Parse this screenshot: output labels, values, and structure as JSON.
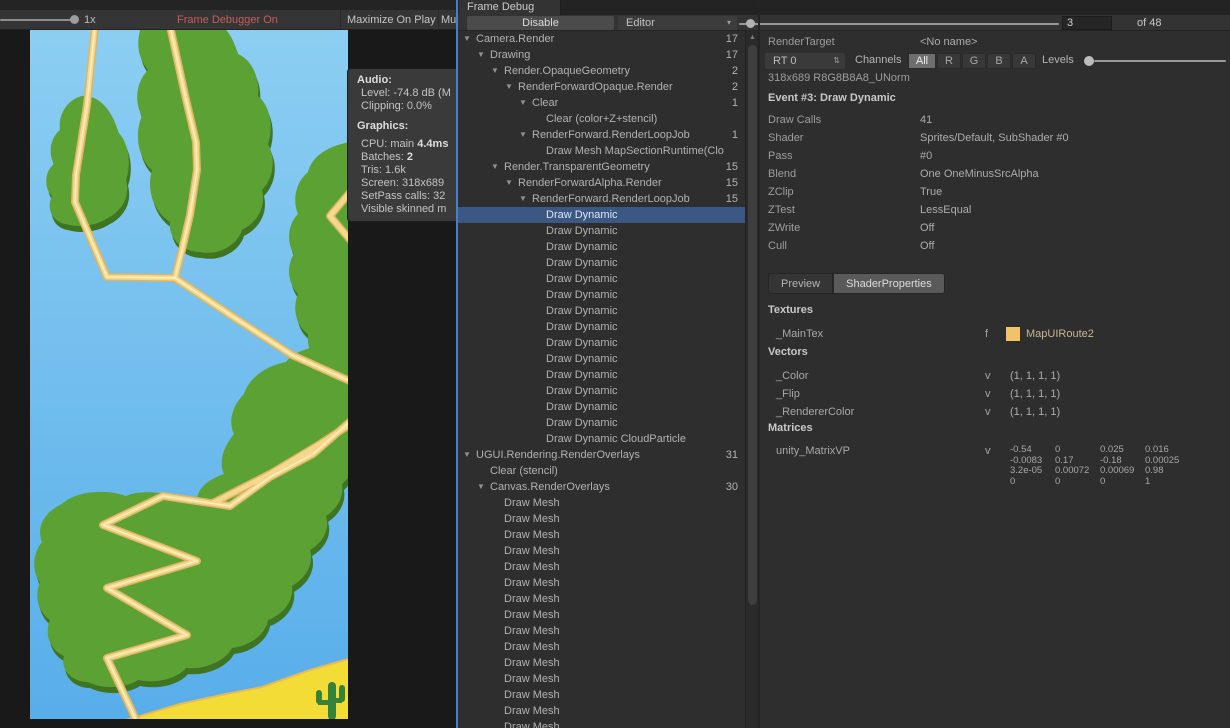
{
  "game_toolbar": {
    "scale_label": "1x",
    "frame_debugger_status": "Frame Debugger On",
    "maximize_on_play_label": "Maximize On Play",
    "mute_label_clipped": "Mu"
  },
  "stats_overlay": {
    "audio_header": "Audio:",
    "audio_lines": [
      {
        "label": "Level: -74.8 dB (M",
        "value": ""
      },
      {
        "label": "Clipping: 0.0%",
        "value": ""
      }
    ],
    "graphics_header": "Graphics:",
    "graphics_lines": [
      {
        "label": "CPU: main ",
        "value": "4.4ms"
      },
      {
        "label": "Batches: ",
        "value": "2"
      },
      {
        "label": "Tris: 1.6k",
        "value": ""
      },
      {
        "label": "Screen: 318x689",
        "value": ""
      },
      {
        "label": "SetPass calls: 32",
        "value": ""
      },
      {
        "label": "Visible skinned m",
        "value": ""
      }
    ]
  },
  "frame_debug": {
    "tab_title": "Frame Debug",
    "toolbar": {
      "disable_button": "Disable",
      "target_dropdown": "Editor",
      "event_number": "3",
      "event_total_label": "of 48"
    },
    "tree": [
      {
        "label": "Camera.Render",
        "count": "17",
        "depth": 0,
        "arrow": true
      },
      {
        "label": "Drawing",
        "count": "17",
        "depth": 1,
        "arrow": true
      },
      {
        "label": "Render.OpaqueGeometry",
        "count": "2",
        "depth": 2,
        "arrow": true
      },
      {
        "label": "RenderForwardOpaque.Render",
        "count": "2",
        "depth": 3,
        "arrow": true
      },
      {
        "label": "Clear",
        "count": "1",
        "depth": 4,
        "arrow": true
      },
      {
        "label": "Clear (color+Z+stencil)",
        "count": "",
        "depth": 5,
        "arrow": false
      },
      {
        "label": "RenderForward.RenderLoopJob",
        "count": "1",
        "depth": 4,
        "arrow": true
      },
      {
        "label": "Draw Mesh MapSectionRuntime(Clo",
        "count": "",
        "depth": 5,
        "arrow": false
      },
      {
        "label": "Render.TransparentGeometry",
        "count": "15",
        "depth": 2,
        "arrow": true
      },
      {
        "label": "RenderForwardAlpha.Render",
        "count": "15",
        "depth": 3,
        "arrow": true
      },
      {
        "label": "RenderForward.RenderLoopJob",
        "count": "15",
        "depth": 4,
        "arrow": true
      },
      {
        "label": "Draw Dynamic",
        "count": "",
        "depth": 5,
        "arrow": false,
        "selected": true
      },
      {
        "label": "Draw Dynamic",
        "count": "",
        "depth": 5,
        "arrow": false
      },
      {
        "label": "Draw Dynamic",
        "count": "",
        "depth": 5,
        "arrow": false
      },
      {
        "label": "Draw Dynamic",
        "count": "",
        "depth": 5,
        "arrow": false
      },
      {
        "label": "Draw Dynamic",
        "count": "",
        "depth": 5,
        "arrow": false
      },
      {
        "label": "Draw Dynamic",
        "count": "",
        "depth": 5,
        "arrow": false
      },
      {
        "label": "Draw Dynamic",
        "count": "",
        "depth": 5,
        "arrow": false
      },
      {
        "label": "Draw Dynamic",
        "count": "",
        "depth": 5,
        "arrow": false
      },
      {
        "label": "Draw Dynamic",
        "count": "",
        "depth": 5,
        "arrow": false
      },
      {
        "label": "Draw Dynamic",
        "count": "",
        "depth": 5,
        "arrow": false
      },
      {
        "label": "Draw Dynamic",
        "count": "",
        "depth": 5,
        "arrow": false
      },
      {
        "label": "Draw Dynamic",
        "count": "",
        "depth": 5,
        "arrow": false
      },
      {
        "label": "Draw Dynamic",
        "count": "",
        "depth": 5,
        "arrow": false
      },
      {
        "label": "Draw Dynamic",
        "count": "",
        "depth": 5,
        "arrow": false
      },
      {
        "label": "Draw Dynamic CloudParticle",
        "count": "",
        "depth": 5,
        "arrow": false
      },
      {
        "label": "UGUI.Rendering.RenderOverlays",
        "count": "31",
        "depth": 0,
        "arrow": true
      },
      {
        "label": "Clear (stencil)",
        "count": "",
        "depth": 1,
        "arrow": false
      },
      {
        "label": "Canvas.RenderOverlays",
        "count": "30",
        "depth": 1,
        "arrow": true
      },
      {
        "label": "Draw Mesh",
        "count": "",
        "depth": 2,
        "arrow": false
      },
      {
        "label": "Draw Mesh",
        "count": "",
        "depth": 2,
        "arrow": false
      },
      {
        "label": "Draw Mesh",
        "count": "",
        "depth": 2,
        "arrow": false
      },
      {
        "label": "Draw Mesh",
        "count": "",
        "depth": 2,
        "arrow": false
      },
      {
        "label": "Draw Mesh",
        "count": "",
        "depth": 2,
        "arrow": false
      },
      {
        "label": "Draw Mesh",
        "count": "",
        "depth": 2,
        "arrow": false
      },
      {
        "label": "Draw Mesh",
        "count": "",
        "depth": 2,
        "arrow": false
      },
      {
        "label": "Draw Mesh",
        "count": "",
        "depth": 2,
        "arrow": false
      },
      {
        "label": "Draw Mesh",
        "count": "",
        "depth": 2,
        "arrow": false
      },
      {
        "label": "Draw Mesh",
        "count": "",
        "depth": 2,
        "arrow": false
      },
      {
        "label": "Draw Mesh",
        "count": "",
        "depth": 2,
        "arrow": false
      },
      {
        "label": "Draw Mesh",
        "count": "",
        "depth": 2,
        "arrow": false
      },
      {
        "label": "Draw Mesh",
        "count": "",
        "depth": 2,
        "arrow": false
      },
      {
        "label": "Draw Mesh",
        "count": "",
        "depth": 2,
        "arrow": false
      },
      {
        "label": "Draw Mesh",
        "count": "",
        "depth": 2,
        "arrow": false
      }
    ]
  },
  "details": {
    "render_target_label": "RenderTarget",
    "render_target_value": "<No name>",
    "rt_dropdown": "RT 0",
    "channels_label": "Channels",
    "channels": [
      "All",
      "R",
      "G",
      "B",
      "A"
    ],
    "active_channel": "All",
    "levels_label": "Levels",
    "buffer_info": "318x689 R8G8B8A8_UNorm",
    "event_title": "Event #3: Draw Dynamic",
    "properties": [
      {
        "label": "Draw Calls",
        "value": "41"
      },
      {
        "label": "Shader",
        "value": "Sprites/Default, SubShader #0"
      },
      {
        "label": "Pass",
        "value": "#0"
      },
      {
        "label": "Blend",
        "value": "One OneMinusSrcAlpha"
      },
      {
        "label": "ZClip",
        "value": "True"
      },
      {
        "label": "ZTest",
        "value": "LessEqual"
      },
      {
        "label": "ZWrite",
        "value": "Off"
      },
      {
        "label": "Cull",
        "value": "Off"
      }
    ],
    "tabs": [
      {
        "label": "Preview",
        "active": false
      },
      {
        "label": "ShaderProperties",
        "active": true
      }
    ],
    "sections": {
      "textures": {
        "header": "Textures",
        "rows": [
          {
            "name": "_MainTex",
            "type": "f",
            "texture_name": "MapUIRoute2",
            "swatch_color": "#f2c268"
          }
        ]
      },
      "vectors": {
        "header": "Vectors",
        "rows": [
          {
            "name": "_Color",
            "type": "v",
            "value": "(1, 1, 1, 1)"
          },
          {
            "name": "_Flip",
            "type": "v",
            "value": "(1, 1, 1, 1)"
          },
          {
            "name": "_RendererColor",
            "type": "v",
            "value": "(1, 1, 1, 1)"
          }
        ]
      },
      "matrices": {
        "header": "Matrices",
        "rows": [
          {
            "name": "unity_MatrixVP",
            "type": "v",
            "matrix": [
              [
                "-0.54",
                "0",
                "0.025",
                "0.016"
              ],
              [
                "-0.0083",
                "0.17",
                "-0.18",
                "0.00025"
              ],
              [
                "3.2e-05",
                "0.00072",
                "0.00069",
                "0.98"
              ],
              [
                "0",
                "0",
                "0",
                "1"
              ]
            ]
          }
        ]
      }
    }
  },
  "colors": {
    "selection_blue": "#3b5784",
    "frame_debugger_on_text": "#c85c5c",
    "focus_outline_blue": "#4a7fc1",
    "water_top": "#8ccef2",
    "water_bottom": "#58aeea",
    "land_green": "#5ba134",
    "land_shadow_green": "#3f7520",
    "route_tan": "#f6d78e",
    "route_edge": "#d9b765",
    "sand_yellow": "#f2dc35",
    "texture_swatch": "#f2c268"
  }
}
